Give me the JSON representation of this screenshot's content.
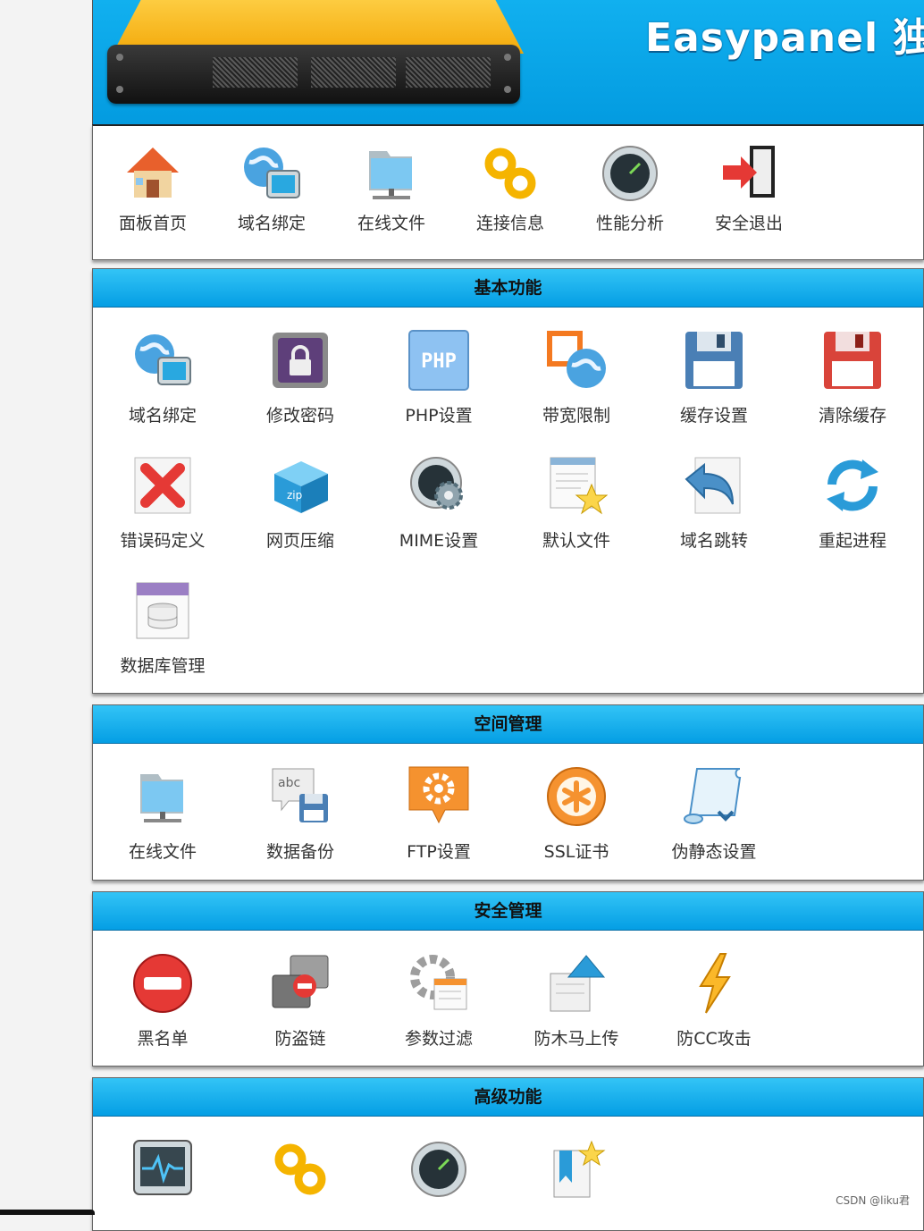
{
  "header": {
    "brand": "Easypanel 独"
  },
  "topnav": {
    "items": [
      {
        "label": "面板首页",
        "icon": "house-icon"
      },
      {
        "label": "域名绑定",
        "icon": "globe-monitor-icon"
      },
      {
        "label": "在线文件",
        "icon": "folder-network-icon"
      },
      {
        "label": "连接信息",
        "icon": "chain-link-icon"
      },
      {
        "label": "性能分析",
        "icon": "gauge-icon"
      },
      {
        "label": "安全退出",
        "icon": "exit-door-icon"
      }
    ]
  },
  "sections": {
    "basic": {
      "title": "基本功能",
      "items": [
        {
          "label": "域名绑定",
          "icon": "globe-monitor-icon"
        },
        {
          "label": "修改密码",
          "icon": "lock-icon"
        },
        {
          "label": "PHP设置",
          "icon": "php-icon"
        },
        {
          "label": "带宽限制",
          "icon": "bandwidth-globe-icon"
        },
        {
          "label": "缓存设置",
          "icon": "floppy-blue-icon"
        },
        {
          "label": "清除缓存",
          "icon": "floppy-red-icon"
        },
        {
          "label": "错误码定义",
          "icon": "red-x-icon"
        },
        {
          "label": "网页压缩",
          "icon": "zip-box-icon"
        },
        {
          "label": "MIME设置",
          "icon": "gear-gauge-icon"
        },
        {
          "label": "默认文件",
          "icon": "document-star-icon"
        },
        {
          "label": "域名跳转",
          "icon": "redirect-arrow-icon"
        },
        {
          "label": "重起进程",
          "icon": "refresh-icon"
        },
        {
          "label": "数据库管理",
          "icon": "database-icon"
        }
      ]
    },
    "space": {
      "title": "空间管理",
      "items": [
        {
          "label": "在线文件",
          "icon": "folder-network-icon"
        },
        {
          "label": "数据备份",
          "icon": "backup-floppy-icon"
        },
        {
          "label": "FTP设置",
          "icon": "ftp-gear-icon"
        },
        {
          "label": "SSL证书",
          "icon": "ssl-badge-icon"
        },
        {
          "label": "伪静态设置",
          "icon": "scroll-icon"
        }
      ]
    },
    "security": {
      "title": "安全管理",
      "items": [
        {
          "label": "黑名单",
          "icon": "no-entry-icon"
        },
        {
          "label": "防盗链",
          "icon": "anti-leech-icon"
        },
        {
          "label": "参数过滤",
          "icon": "filter-gear-icon"
        },
        {
          "label": "防木马上传",
          "icon": "upload-arrow-icon"
        },
        {
          "label": "防CC攻击",
          "icon": "lightning-icon"
        }
      ]
    },
    "advanced": {
      "title": "高级功能",
      "items": [
        {
          "icon": "monitor-pulse-icon"
        },
        {
          "icon": "chain-link-icon"
        },
        {
          "icon": "gauge-icon"
        },
        {
          "icon": "bookmark-star-icon"
        }
      ]
    }
  },
  "footer": {
    "watermark": "CSDN @liku君"
  },
  "colors": {
    "header_blue": "#039be0",
    "accent_blue": "#33c4f6"
  }
}
